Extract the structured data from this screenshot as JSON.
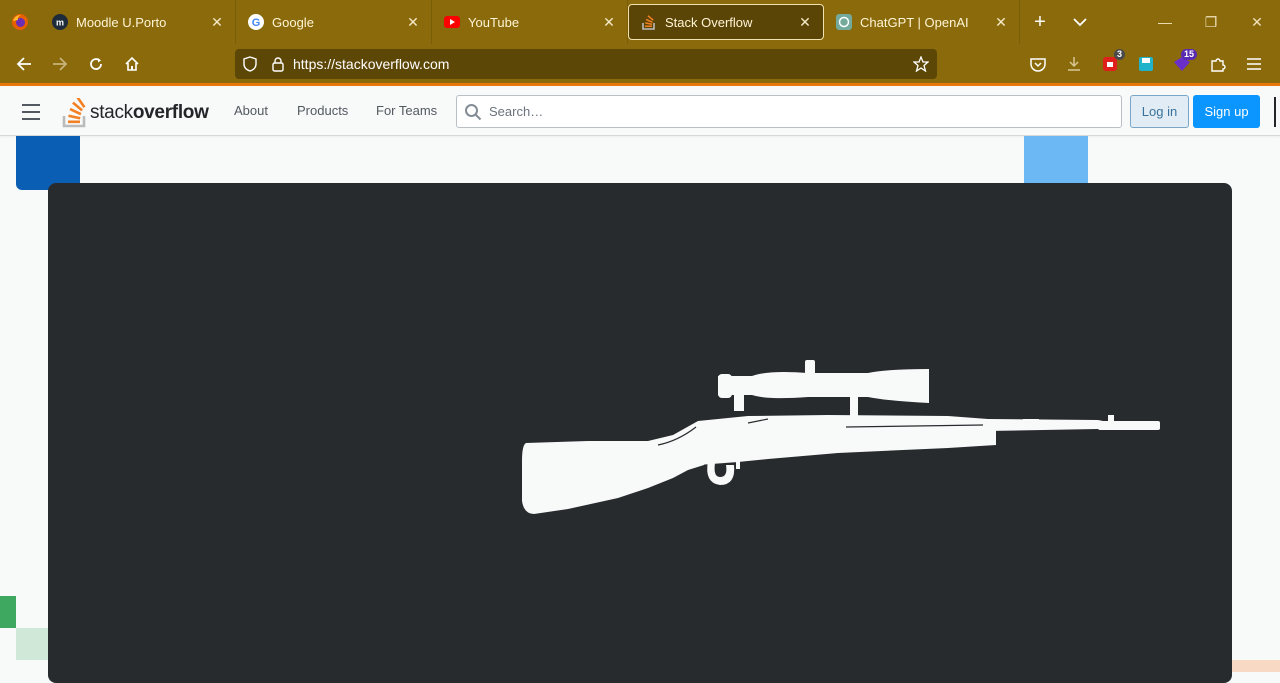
{
  "browser": {
    "tabs": [
      {
        "title": "Moodle U.Porto",
        "icon": "moodle-icon",
        "active": false
      },
      {
        "title": "Google",
        "icon": "google-icon",
        "active": false
      },
      {
        "title": "YouTube",
        "icon": "youtube-icon",
        "active": false
      },
      {
        "title": "Stack Overflow",
        "icon": "stackoverflow-icon",
        "active": true
      },
      {
        "title": "ChatGPT | OpenAI",
        "icon": "openai-icon",
        "active": false
      }
    ],
    "close_glyph": "✕",
    "new_tab_glyph": "+",
    "url": "https://stackoverflow.com",
    "extension_badges": {
      "first": "3",
      "second": "15"
    },
    "window_controls": {
      "minimize": "—",
      "restore": "❐",
      "close": "✕"
    }
  },
  "so_header": {
    "logo": {
      "text_light": "stack",
      "text_bold": "overflow"
    },
    "nav": {
      "about": "About",
      "products": "Products",
      "teams": "For Teams"
    },
    "search_placeholder": "Search…",
    "login_label": "Log in",
    "signup_label": "Sign up"
  },
  "hero": {
    "image": "rifle-silhouette",
    "colors": {
      "modal_bg": "#282b2e",
      "silhouette": "#f8f9f9",
      "accent_blue": "#0a5fb4",
      "accent_light_blue": "#6cb8f5",
      "accent_green": "#3ea760"
    }
  }
}
